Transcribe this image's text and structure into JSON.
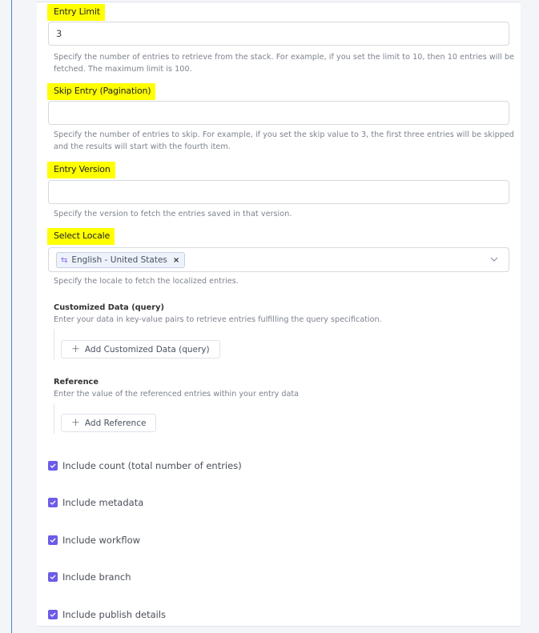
{
  "fields": {
    "entry_limit": {
      "label": "Entry Limit",
      "value": "3",
      "help": "Specify the number of entries to retrieve from the stack. For example, if you set the limit to 10, then 10 entries will be fetched. The maximum limit is 100."
    },
    "skip_entry": {
      "label": "Skip Entry (Pagination)",
      "value": "",
      "help": "Specify the number of entries to skip. For example, if you set the skip value to 3, the first three entries will be skipped and the results will start with the fourth item."
    },
    "entry_version": {
      "label": "Entry Version",
      "value": "",
      "help": "Specify the version to fetch the entries saved in that version."
    },
    "select_locale": {
      "label": "Select Locale",
      "selected_tag": "English - United States",
      "help": "Specify the locale to fetch the localized entries."
    }
  },
  "customized_data": {
    "title": "Customized Data (query)",
    "description": "Enter your data in key-value pairs to retrieve entries fulfilling the query specification.",
    "button_label": "Add Customized Data (query)"
  },
  "reference": {
    "title": "Reference",
    "description": "Enter the value of the referenced entries within your entry data",
    "button_label": "Add Reference"
  },
  "checkboxes": [
    {
      "label": "Include count (total number of entries)",
      "checked": true
    },
    {
      "label": "Include metadata",
      "checked": true
    },
    {
      "label": "Include workflow",
      "checked": true
    },
    {
      "label": "Include branch",
      "checked": true
    },
    {
      "label": "Include publish details",
      "checked": true
    }
  ],
  "colors": {
    "highlight": "#ffff00",
    "checkbox": "#6c5ce7",
    "rail": "#4a7fd0"
  }
}
